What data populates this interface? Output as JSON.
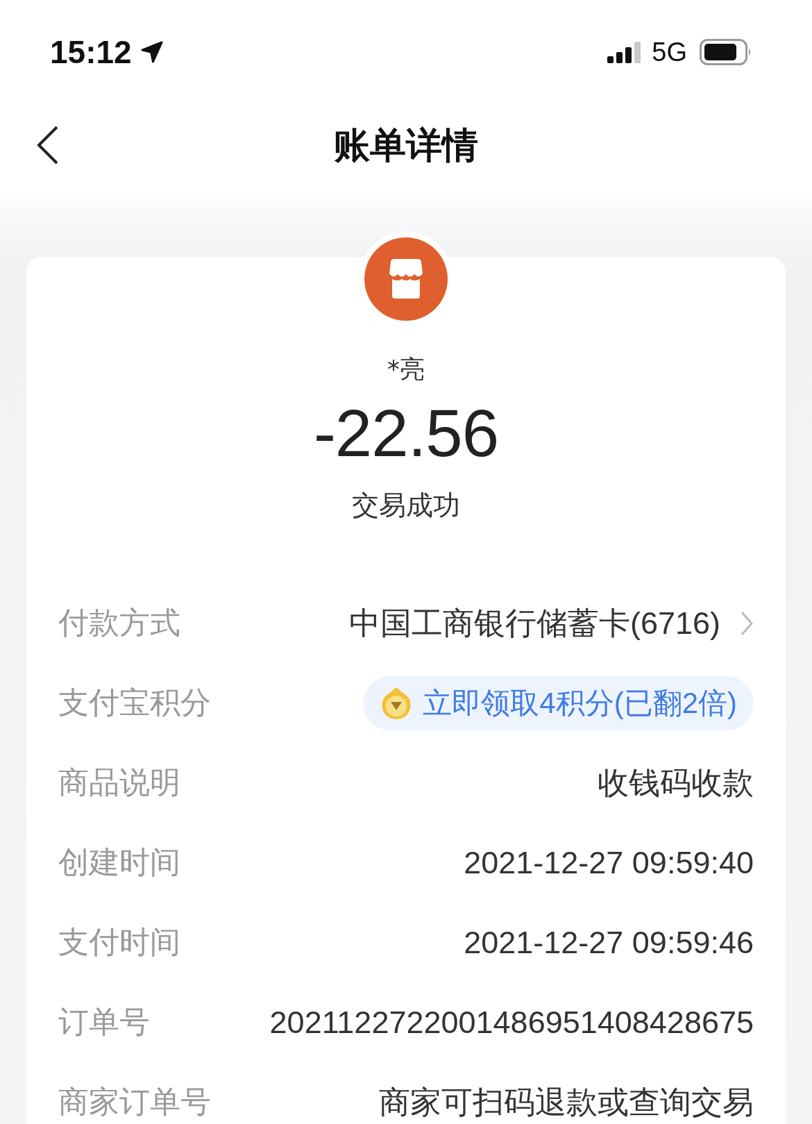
{
  "status_bar": {
    "time": "15:12",
    "network": "5G"
  },
  "nav": {
    "title": "账单详情"
  },
  "summary": {
    "payee": "*亮",
    "amount": "-22.56",
    "status": "交易成功"
  },
  "rows": [
    {
      "kind": "link",
      "label": "付款方式",
      "value": "中国工商银行储蓄卡(6716)"
    },
    {
      "kind": "badge",
      "label": "支付宝积分",
      "value": "立即领取4积分(已翻2倍)"
    },
    {
      "kind": "text",
      "label": "商品说明",
      "value": "收钱码收款"
    },
    {
      "kind": "text",
      "label": "创建时间",
      "value": "2021-12-27 09:59:40"
    },
    {
      "kind": "text",
      "label": "支付时间",
      "value": "2021-12-27 09:59:46"
    },
    {
      "kind": "text",
      "label": "订单号",
      "value": "2021122722001486951408428675"
    },
    {
      "kind": "text",
      "label": "商家订单号",
      "value": "商家可扫码退款或查询交易"
    }
  ]
}
